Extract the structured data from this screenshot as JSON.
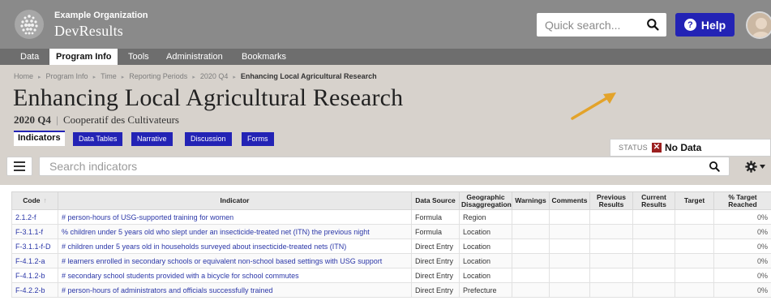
{
  "top": {
    "org_name": "Example Organization",
    "app_name": "DevResults",
    "search_placeholder": "Quick search...",
    "help_label": "Help"
  },
  "nav": [
    "Data",
    "Program Info",
    "Tools",
    "Administration",
    "Bookmarks"
  ],
  "nav_active": "Program Info",
  "breadcrumb": [
    "Home",
    "Program Info",
    "Time",
    "Reporting Periods",
    "2020 Q4",
    "Enhancing Local Agricultural Research"
  ],
  "title": "Enhancing Local Agricultural Research",
  "subtitle": {
    "period": "2020 Q4",
    "separator": "|",
    "partner": "Cooperatif des Cultivateurs"
  },
  "tabs": [
    "Indicators",
    "Data Tables",
    "Narrative",
    "Discussion",
    "Forms"
  ],
  "active_tab": "Indicators",
  "status": {
    "label": "STATUS",
    "value": "No Data",
    "icon": "x-icon",
    "color": "#9b1f1f"
  },
  "search": {
    "placeholder": "Search indicators"
  },
  "table": {
    "columns": [
      "Code",
      "Indicator",
      "Data Source",
      "Geographic Disaggregation",
      "Warnings",
      "Comments",
      "Previous Results",
      "Current Results",
      "Target",
      "% Target Reached"
    ],
    "rows": [
      [
        "2.1.2-f",
        "# person-hours of USG-supported training for women",
        "Formula",
        "Region",
        "",
        "",
        "",
        "",
        "",
        "0%"
      ],
      [
        "F-3.1.1-f",
        "% children under 5 years old who slept under an insecticide-treated net (ITN) the previous night",
        "Formula",
        "Location",
        "",
        "",
        "",
        "",
        "",
        "0%"
      ],
      [
        "F-3.1.1-f-D",
        "# children under 5 years old in households surveyed about insecticide-treated nets (ITN)",
        "Direct Entry",
        "Location",
        "",
        "",
        "",
        "",
        "",
        "0%"
      ],
      [
        "F-4.1.2-a",
        "# learners enrolled in secondary schools or equivalent non-school based settings with USG support",
        "Direct Entry",
        "Location",
        "",
        "",
        "",
        "",
        "",
        "0%"
      ],
      [
        "F-4.1.2-b",
        "# secondary school students provided with a bicycle for school commutes",
        "Direct Entry",
        "Location",
        "",
        "",
        "",
        "",
        "",
        "0%"
      ],
      [
        "F-4.2.2-b",
        "# person-hours of administrators and officials successfully trained",
        "Direct Entry",
        "Prefecture",
        "",
        "",
        "",
        "",
        "",
        "0%"
      ]
    ]
  },
  "colors": {
    "topbar": "#8a8a8a",
    "nav": "#6e6e6e",
    "header": "#d7d2cc",
    "accent": "#2323b5",
    "link": "#2b37a8",
    "arrow": "#e3a32a"
  }
}
